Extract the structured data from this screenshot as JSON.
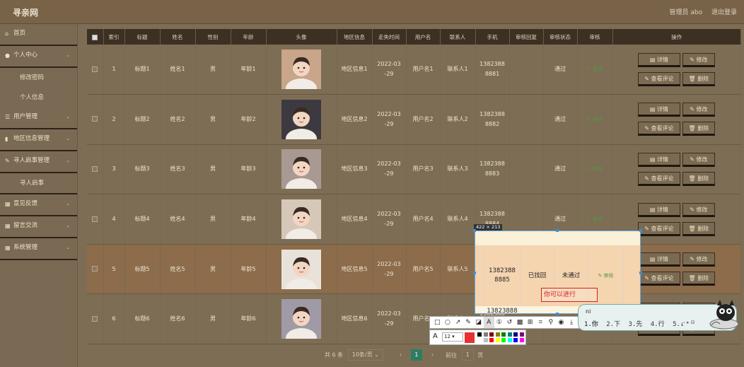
{
  "app": {
    "logo": "寻亲网",
    "admin_label": "管理员 abo",
    "logout": "退出登录"
  },
  "sidebar": {
    "home": "首页",
    "personal": "个人中心",
    "change_pwd": "修改密码",
    "profile": "个人信息",
    "users": "用户管理",
    "region": "地区信息管理",
    "notice": "寻人启事管理",
    "notice_sub": "寻人启事",
    "feedback": "意见反馈",
    "message": "留言交流",
    "system": "系统管理"
  },
  "table": {
    "headers": [
      "索引",
      "标题",
      "姓名",
      "性别",
      "年龄",
      "头像",
      "地区信息",
      "走失时间",
      "用户名",
      "联系人",
      "手机",
      "审核回复",
      "审核状态",
      "审核",
      "操作"
    ],
    "rows": [
      {
        "idx": "1",
        "title": "标题1",
        "name": "姓名1",
        "sex": "男",
        "age": "年龄1",
        "region": "地区信息1",
        "date": "2022-03-29",
        "user": "用户名1",
        "contact": "联系人1",
        "phone": "13823888881",
        "reply": "",
        "status": "通过",
        "audit": "审核"
      },
      {
        "idx": "2",
        "title": "标题2",
        "name": "姓名2",
        "sex": "男",
        "age": "年龄2",
        "region": "地区信息2",
        "date": "2022-03-29",
        "user": "用户名2",
        "contact": "联系人2",
        "phone": "13823888882",
        "reply": "",
        "status": "通过",
        "audit": "审核"
      },
      {
        "idx": "3",
        "title": "标题3",
        "name": "姓名3",
        "sex": "男",
        "age": "年龄3",
        "region": "地区信息3",
        "date": "2022-03-29",
        "user": "用户名3",
        "contact": "联系人3",
        "phone": "13823888883",
        "reply": "",
        "status": "通过",
        "audit": "审核"
      },
      {
        "idx": "4",
        "title": "标题4",
        "name": "姓名4",
        "sex": "男",
        "age": "年龄4",
        "region": "地区信息4",
        "date": "2022-03-29",
        "user": "用户名4",
        "contact": "联系人4",
        "phone": "13823888884",
        "reply": "",
        "status": "通过",
        "audit": "审核"
      },
      {
        "idx": "5",
        "title": "标题5",
        "name": "姓名5",
        "sex": "男",
        "age": "年龄5",
        "region": "地区信息5",
        "date": "2022-03-29",
        "user": "用户名5",
        "contact": "联系人5",
        "phone": "13823888885",
        "reply": "已找回",
        "status": "未通过",
        "audit": "审核"
      },
      {
        "idx": "6",
        "title": "标题6",
        "name": "姓名6",
        "sex": "男",
        "age": "年龄6",
        "region": "地区信息6",
        "date": "2022-03-29",
        "user": "用户名6",
        "contact": "联系人6",
        "phone": "13823888886",
        "reply": "",
        "status": "",
        "audit": ""
      }
    ],
    "ops": {
      "detail": "详情",
      "edit": "修改",
      "comments": "查看评论",
      "delete": "删除"
    }
  },
  "pager": {
    "total": "共 6 条",
    "per_page": "10条/页",
    "prev": "‹",
    "current": "1",
    "next": "›",
    "goto": "前往",
    "page_input": "1",
    "page_unit": "页"
  },
  "screenshot_tool": {
    "size_badge": "422 × 213",
    "text_input": "你可以进行",
    "font_size": "12",
    "tools": [
      "rect-icon",
      "ellipse-icon",
      "arrow-icon",
      "pen-icon",
      "marker-icon",
      "text-icon",
      "number-icon",
      "undo-icon",
      "mosaic-icon",
      "pin-icon",
      "ocr-icon",
      "translate-icon",
      "record-icon",
      "save-icon"
    ],
    "current_color": "#e83030",
    "swatches": [
      "#000000",
      "#808080",
      "#800000",
      "#808000",
      "#008000",
      "#008080",
      "#000080",
      "#800080",
      "#ffffff",
      "#c0c0c0",
      "#ff0000",
      "#ffff00",
      "#00ff00",
      "#00ffff",
      "#0000ff",
      "#ff00ff"
    ]
  },
  "ime": {
    "composition": "ni",
    "candidates": [
      "1.你",
      "2.下",
      "3.先",
      "4.行",
      "5.↓"
    ],
    "nav": "‹ ▸ ⊟"
  }
}
